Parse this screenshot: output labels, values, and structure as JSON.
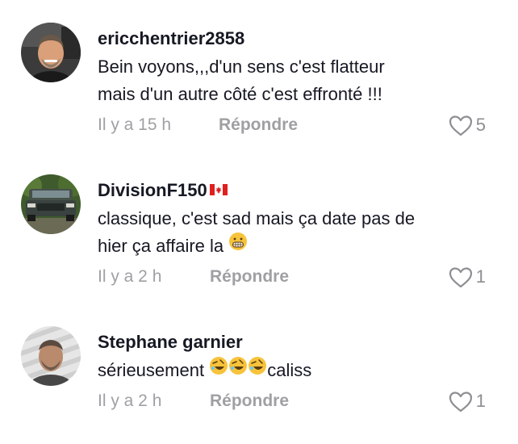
{
  "comments": [
    {
      "username": "ericchentrier2858",
      "lines": [
        "Bein voyons,,,d'un sens c'est flatteur",
        "mais d'un autre côté c'est effronté !!!"
      ],
      "time": "Il y a 15 h",
      "reply_label": "Répondre",
      "likes": "5"
    },
    {
      "username": "DivisionF150",
      "lines": [
        "classique, c'est sad mais ça date pas de",
        "hier ça affaire la"
      ],
      "time": "Il y a 2 h",
      "reply_label": "Répondre",
      "likes": "1"
    },
    {
      "username": "Stephane garnier",
      "lines": [
        "sérieusement",
        "caliss"
      ],
      "time": "Il y a 2 h",
      "reply_label": "Répondre",
      "likes": "1"
    }
  ]
}
